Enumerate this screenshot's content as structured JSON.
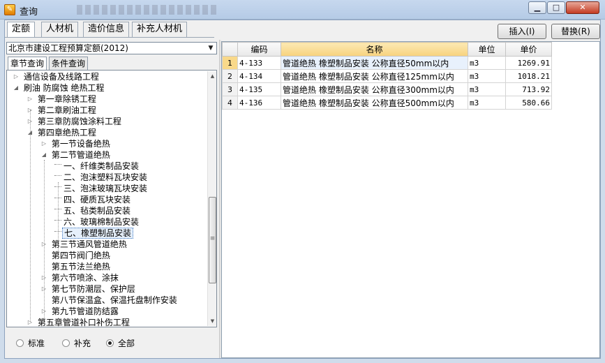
{
  "window": {
    "title": "查询",
    "icon": "app-icon"
  },
  "top_tabs": [
    "定额",
    "人材机",
    "造价信息",
    "补充人材机"
  ],
  "actions": {
    "insert": "插入(I)",
    "replace": "替换(R)"
  },
  "dropdown": {
    "value": "北京市建设工程预算定额(2012)"
  },
  "sub_tabs": [
    "章节查询",
    "条件查询"
  ],
  "tree": [
    {
      "label": "通信设备及线路工程",
      "indent": 0,
      "expander": "collapsed"
    },
    {
      "label": "刷油 防腐蚀 绝热工程",
      "indent": 0,
      "expander": "expanded"
    },
    {
      "label": "第一章除锈工程",
      "indent": 1,
      "expander": "collapsed"
    },
    {
      "label": "第二章刷油工程",
      "indent": 1,
      "expander": "collapsed"
    },
    {
      "label": "第三章防腐蚀涂料工程",
      "indent": 1,
      "expander": "collapsed"
    },
    {
      "label": "第四章绝热工程",
      "indent": 1,
      "expander": "expanded"
    },
    {
      "label": "第一节设备绝热",
      "indent": 2,
      "expander": "collapsed"
    },
    {
      "label": "第二节管道绝热",
      "indent": 2,
      "expander": "expanded"
    },
    {
      "label": "一、纤维类制品安装",
      "indent": 3,
      "expander": "leaf"
    },
    {
      "label": "二、泡沫塑料瓦块安装",
      "indent": 3,
      "expander": "leaf"
    },
    {
      "label": "三、泡沫玻璃瓦块安装",
      "indent": 3,
      "expander": "leaf"
    },
    {
      "label": "四、硬质瓦块安装",
      "indent": 3,
      "expander": "leaf"
    },
    {
      "label": "五、毡类制品安装",
      "indent": 3,
      "expander": "leaf"
    },
    {
      "label": "六、玻璃棉制品安装",
      "indent": 3,
      "expander": "leaf"
    },
    {
      "label": "七、橡塑制品安装",
      "indent": 3,
      "expander": "leaf",
      "selected": true
    },
    {
      "label": "第三节通风管道绝热",
      "indent": 2,
      "expander": "collapsed"
    },
    {
      "label": "第四节阀门绝热",
      "indent": 2,
      "expander": "none"
    },
    {
      "label": "第五节法兰绝热",
      "indent": 2,
      "expander": "none"
    },
    {
      "label": "第六节喷涂、涂抹",
      "indent": 2,
      "expander": "collapsed"
    },
    {
      "label": "第七节防潮层、保护层",
      "indent": 2,
      "expander": "collapsed"
    },
    {
      "label": "第八节保温盒、保温托盘制作安装",
      "indent": 2,
      "expander": "none"
    },
    {
      "label": "第九节管道防结露",
      "indent": 2,
      "expander": "collapsed"
    },
    {
      "label": "第五章管道补口补伤工程",
      "indent": 1,
      "expander": "collapsed"
    }
  ],
  "filter": {
    "options": [
      "标准",
      "补充",
      "全部"
    ],
    "selected": "全部"
  },
  "grid": {
    "columns": [
      "",
      "编码",
      "名称",
      "单位",
      "单价"
    ],
    "highlight_column": "名称",
    "rows": [
      {
        "num": "1",
        "code": "4-133",
        "name": "管道绝热 橡塑制品安装 公称直径50mm以内",
        "unit": "m3",
        "price": "1269.91",
        "selected": true
      },
      {
        "num": "2",
        "code": "4-134",
        "name": "管道绝热 橡塑制品安装 公称直径125mm以内",
        "unit": "m3",
        "price": "1018.21"
      },
      {
        "num": "3",
        "code": "4-135",
        "name": "管道绝热 橡塑制品安装 公称直径300mm以内",
        "unit": "m3",
        "price": "713.92"
      },
      {
        "num": "4",
        "code": "4-136",
        "name": "管道绝热 橡塑制品安装 公称直径500mm以内",
        "unit": "m3",
        "price": "580.66"
      }
    ]
  }
}
